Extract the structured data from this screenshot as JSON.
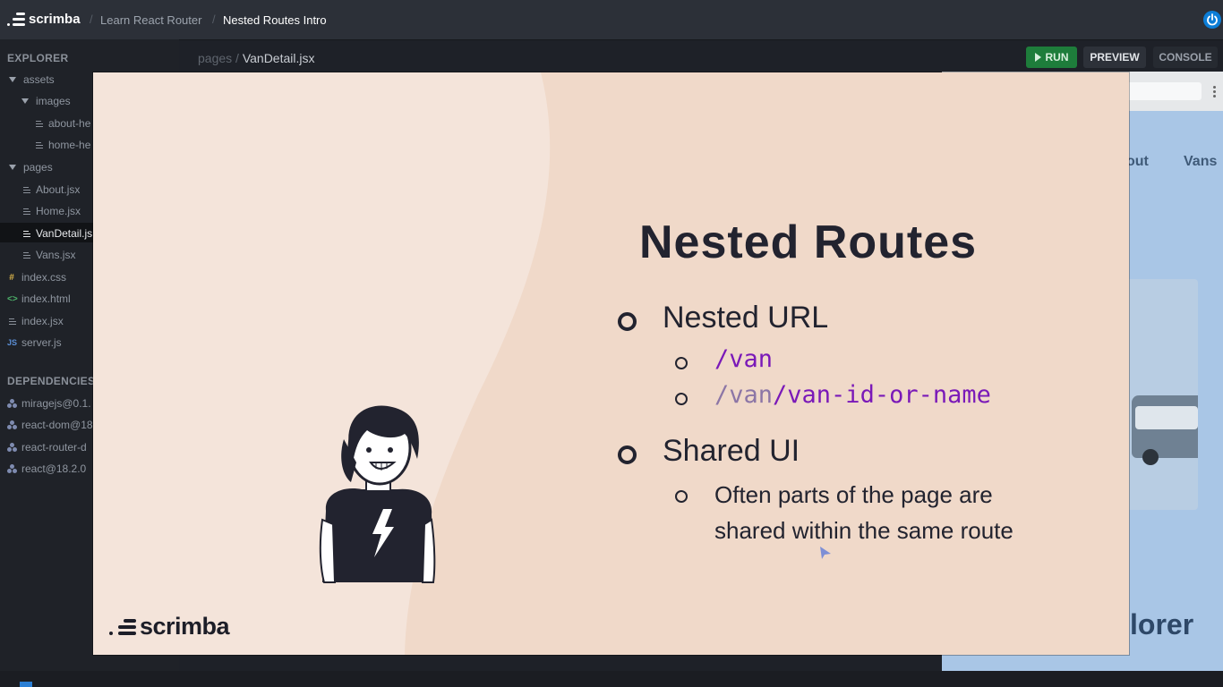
{
  "topbar": {
    "logo_text": "scrimba",
    "breadcrumbs": [
      "Learn React Router",
      "Nested Routes Intro"
    ]
  },
  "sidebar": {
    "explorer_heading": "EXPLORER",
    "dependencies_heading": "DEPENDENCIES",
    "tree": [
      {
        "label": "assets",
        "type": "folder"
      },
      {
        "label": "images",
        "type": "folder"
      },
      {
        "label": "about-he",
        "type": "file"
      },
      {
        "label": "home-he",
        "type": "file"
      },
      {
        "label": "pages",
        "type": "folder"
      },
      {
        "label": "About.jsx",
        "type": "file"
      },
      {
        "label": "Home.jsx",
        "type": "file"
      },
      {
        "label": "VanDetail.js",
        "type": "file",
        "selected": true
      },
      {
        "label": "Vans.jsx",
        "type": "file"
      },
      {
        "label": "index.css",
        "type": "css"
      },
      {
        "label": "index.html",
        "type": "html"
      },
      {
        "label": "index.jsx",
        "type": "file"
      },
      {
        "label": "server.js",
        "type": "js"
      }
    ],
    "dependencies": [
      "miragejs@0.1.",
      "react-dom@18.",
      "react-router-d",
      "react@18.2.0"
    ]
  },
  "editor": {
    "path_prefix": "pages /",
    "path_file": "VanDetail.jsx"
  },
  "toolbar": {
    "run_label": "RUN",
    "preview_label": "PREVIEW",
    "console_label": "CONSOLE"
  },
  "preview": {
    "nav_partial": "out",
    "nav_vans": "Vans",
    "explorer_partial": "lorer"
  },
  "slide": {
    "title": "Nested Routes",
    "bullet1": "Nested URL",
    "code1": "/van",
    "code2_dim": "/van",
    "code2_rest": "/van-id-or-name",
    "bullet2": "Shared UI",
    "sub_line1": "Often parts of the page are",
    "sub_line2": "shared within the same route",
    "brand": "scrimba"
  },
  "colors": {
    "slide_bg": "#f0d9c9",
    "code_purple": "#7a19b8",
    "run_green": "#1e7d3b",
    "accent_blue": "#0c7dd6"
  }
}
